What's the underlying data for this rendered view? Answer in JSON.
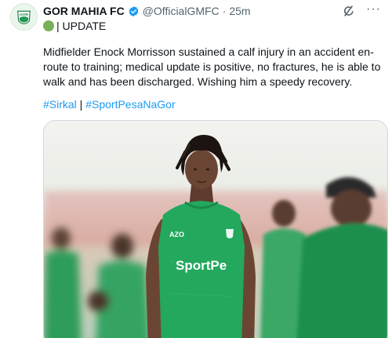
{
  "tweet": {
    "author_name": "GOR MAHIA FC",
    "handle": "@OfficialGMFC",
    "separator": "·",
    "time": "25m",
    "more_label": "···",
    "update_label": "| UPDATE",
    "text": "Midfielder Enock Morrisson sustained a calf injury in an accident en-route to training; medical update is positive, no fractures, he is able to walk and has been discharged. Wishing him a speedy recovery.",
    "hashtag_1": "#Sirkal",
    "hashtag_sep": " | ",
    "hashtag_2": "#SportPesaNaGor",
    "avatar_text": "GOR",
    "shirt_brand": "AZO",
    "shirt_sponsor": "SportPe",
    "colors": {
      "verified_blue": "#1d9bf0",
      "hashtag_blue": "#1d9bf0",
      "club_green": "#1e9a55",
      "muted_text": "#536471"
    }
  }
}
